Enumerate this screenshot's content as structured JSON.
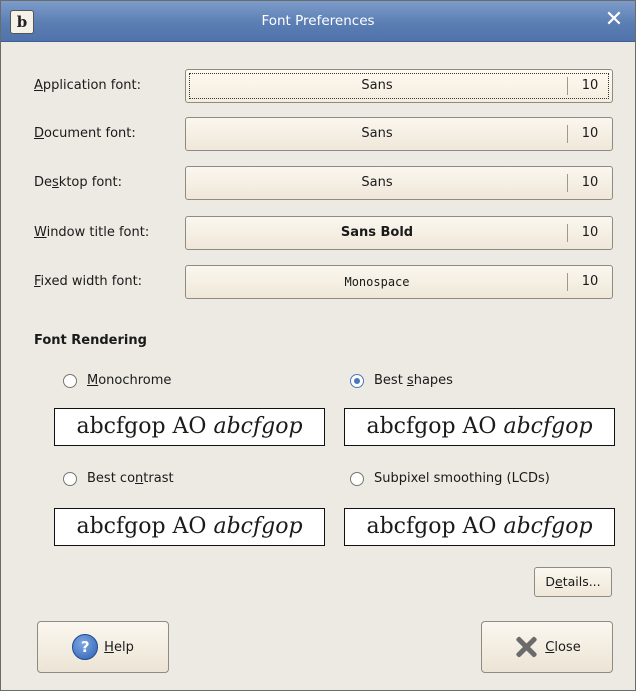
{
  "window": {
    "title": "Font Preferences",
    "app_icon_glyph": "b",
    "close_glyph": "✕"
  },
  "fonts": [
    {
      "label_pre": "",
      "label_u": "A",
      "label_post": "pplication font:",
      "font": "Sans",
      "size": "10",
      "weight": "normal",
      "family": "sans"
    },
    {
      "label_pre": "",
      "label_u": "D",
      "label_post": "ocument font:",
      "font": "Sans",
      "size": "10",
      "weight": "normal",
      "family": "sans"
    },
    {
      "label_pre": "De",
      "label_u": "s",
      "label_post": "ktop font:",
      "font": "Sans",
      "size": "10",
      "weight": "normal",
      "family": "sans"
    },
    {
      "label_pre": "",
      "label_u": "W",
      "label_post": "indow title font:",
      "font": "Sans Bold",
      "size": "10",
      "weight": "bold",
      "family": "sans"
    },
    {
      "label_pre": "",
      "label_u": "F",
      "label_post": "ixed width font:",
      "font": "Monospace",
      "size": "10",
      "weight": "normal",
      "family": "mono"
    }
  ],
  "rendering": {
    "title": "Font Rendering",
    "options": [
      {
        "label_pre": "",
        "label_u": "M",
        "label_post": "onochrome",
        "checked": false
      },
      {
        "label_pre": "Best ",
        "label_u": "s",
        "label_post": "hapes",
        "checked": true
      },
      {
        "label_pre": "Best co",
        "label_u": "n",
        "label_post": "trast",
        "checked": false
      },
      {
        "label_pre": "Subpixel smoothing (LCDs)",
        "label_u": "",
        "label_post": "",
        "checked": false
      }
    ],
    "sample_regular": "abcfgop AO ",
    "sample_italic": "abcfgop"
  },
  "buttons": {
    "details_pre": "D",
    "details_u": "e",
    "details_post": "tails...",
    "help_u": "H",
    "help_post": "elp",
    "close_u": "C",
    "close_post": "lose"
  },
  "icons": {
    "help": "help-icon",
    "close": "close-icon",
    "app": "font-app-icon"
  }
}
